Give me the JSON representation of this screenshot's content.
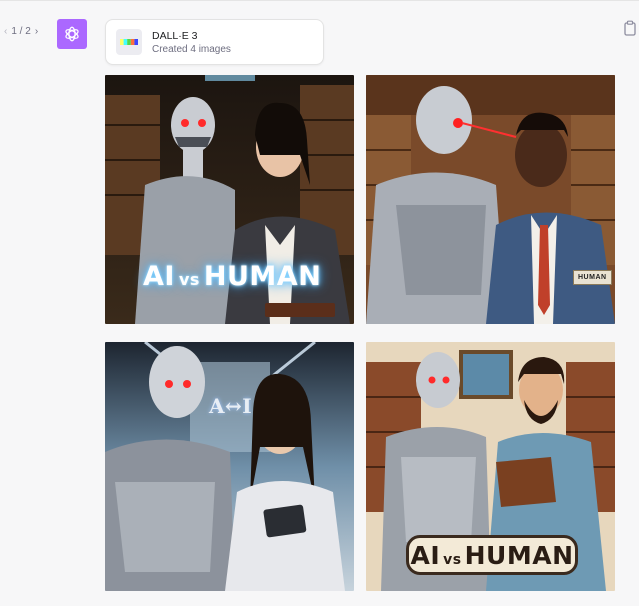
{
  "pager": {
    "text": "1 / 2",
    "prev": "‹",
    "next": "›"
  },
  "avatar": {
    "icon": "openai-logo-icon",
    "color": "#ab68ff"
  },
  "card": {
    "title": "DALL·E 3",
    "subtitle": "Created 4 images"
  },
  "actions": {
    "copy_icon": "clipboard-icon"
  },
  "images": [
    {
      "banner_left": "AI",
      "banner_vs": "vs",
      "banner_right": "HUMAN"
    },
    {
      "badge": "HUMAN"
    },
    {
      "sign": "A↔I"
    },
    {
      "banner_left": "AI",
      "banner_vs": "vs",
      "banner_right": "HUMAN"
    }
  ]
}
